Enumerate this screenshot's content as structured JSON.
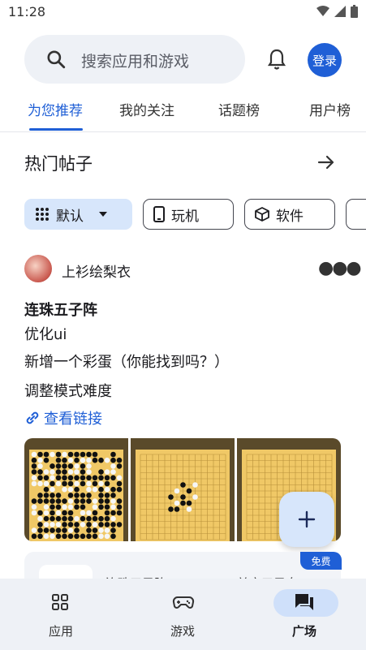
{
  "status_bar": {
    "time": "11:28"
  },
  "search": {
    "placeholder": "搜索应用和游戏"
  },
  "header": {
    "login_label": "登录"
  },
  "tabs": [
    {
      "label": "为您推荐",
      "active": true
    },
    {
      "label": "我的关注"
    },
    {
      "label": "话题榜"
    },
    {
      "label": "用户榜"
    }
  ],
  "section": {
    "title": "热门帖子"
  },
  "chips": [
    {
      "label": "默认",
      "icon": "grid-icon",
      "selected": true
    },
    {
      "label": "玩机",
      "icon": "phone-icon"
    },
    {
      "label": "软件",
      "icon": "cube-icon"
    }
  ],
  "post": {
    "author": "上衫绘梨衣",
    "title": "连珠五子阵",
    "lines": [
      "优化ui",
      "新增一个彩蛋（你能找到吗？）",
      "调整模式难度"
    ],
    "link_label": "查看链接",
    "images": [
      "gomoku-board-full",
      "gomoku-board-center",
      "gomoku-board-empty"
    ]
  },
  "app_card": {
    "badge": "免费",
    "name": "连珠五子阵",
    "extra": "益育五子息"
  },
  "bottom_nav": [
    {
      "label": "应用",
      "icon": "apps-icon"
    },
    {
      "label": "游戏",
      "icon": "gamepad-icon"
    },
    {
      "label": "广场",
      "icon": "forum-icon",
      "active": true
    }
  ],
  "colors": {
    "accent": "#1f5fd6",
    "chip_selected": "#d7e6fb",
    "nav_bg": "#eef1f6"
  }
}
